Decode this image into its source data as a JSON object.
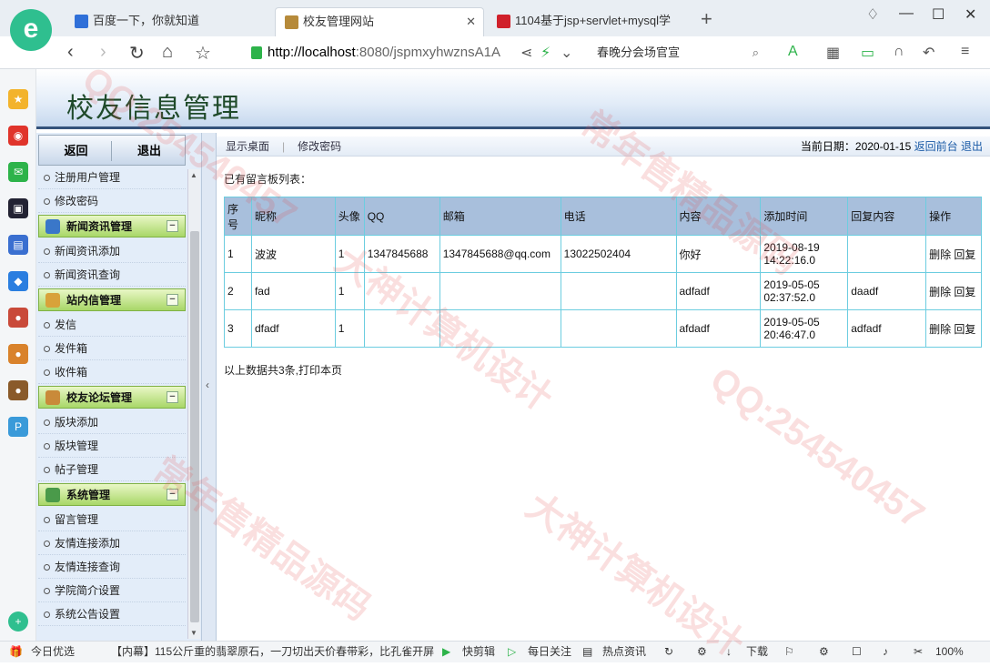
{
  "browser": {
    "tabs": [
      {
        "label": "百度一下，你就知道",
        "fav_color": "#2f6fd8"
      },
      {
        "label": "校友管理网站",
        "fav_color": "#b68a3a"
      },
      {
        "label": "1104基于jsp+servlet+mysql学",
        "fav_color": "#d0202a"
      }
    ],
    "url_host": "http://localhost",
    "url_rest": ":8080/jspmxyhwznsA1A",
    "search_text": "春晚分会场官宣",
    "logo_glyph": "e"
  },
  "app": {
    "title": "校友信息管理",
    "sidebar_buttons": {
      "back": "返回",
      "exit": "退出"
    },
    "sidebar": [
      {
        "type": "item",
        "label": "注册用户管理"
      },
      {
        "type": "item",
        "label": "修改密码"
      },
      {
        "type": "group",
        "label": "新闻资讯管理",
        "icon_color": "#3a77c9"
      },
      {
        "type": "item",
        "label": "新闻资讯添加"
      },
      {
        "type": "item",
        "label": "新闻资讯查询"
      },
      {
        "type": "group",
        "label": "站内信管理",
        "icon_color": "#d8a23a"
      },
      {
        "type": "item",
        "label": "发信"
      },
      {
        "type": "item",
        "label": "发件箱"
      },
      {
        "type": "item",
        "label": "收件箱"
      },
      {
        "type": "group",
        "label": "校友论坛管理",
        "icon_color": "#c98a3a"
      },
      {
        "type": "item",
        "label": "版块添加"
      },
      {
        "type": "item",
        "label": "版块管理"
      },
      {
        "type": "item",
        "label": "帖子管理"
      },
      {
        "type": "group",
        "label": "系统管理",
        "icon_color": "#4a9a4a"
      },
      {
        "type": "item",
        "label": "留言管理"
      },
      {
        "type": "item",
        "label": "友情连接添加"
      },
      {
        "type": "item",
        "label": "友情连接查询"
      },
      {
        "type": "item",
        "label": "学院简介设置"
      },
      {
        "type": "item",
        "label": "系统公告设置"
      }
    ],
    "topbar": {
      "show_desktop": "显示桌面",
      "change_password": "修改密码",
      "date_label": "当前日期：2020-01-15",
      "back_front": "返回前台",
      "logout": "退出"
    },
    "heading": "已有留言板列表：",
    "table": {
      "headers": [
        "序号",
        "昵称",
        "头像",
        "QQ",
        "邮箱",
        "电话",
        "内容",
        "添加时间",
        "回复内容",
        "操作"
      ],
      "rows": [
        [
          "1",
          "波波",
          "1",
          "1347845688",
          "1347845688@qq.com",
          "13022502404",
          "你好",
          "2019-08-19 14:22:16.0",
          "",
          ""
        ],
        [
          "2",
          "fad",
          "1",
          "",
          "",
          "",
          "adfadf",
          "2019-05-05 02:37:52.0",
          "daadf",
          ""
        ],
        [
          "3",
          "dfadf",
          "1",
          "",
          "",
          "",
          "afdadf",
          "2019-05-05 20:46:47.0",
          "adfadf",
          ""
        ]
      ],
      "action_delete": "删除",
      "action_reply": "回复"
    },
    "footer": "以上数据共3条,打印本页"
  },
  "statusbar": {
    "left": "今日优选",
    "news": "【内幕】115公斤重的翡翠原石，一刀切出天价春带彩，比孔雀开屏",
    "clip": "快剪辑",
    "daily": "每日关注",
    "hot": "热点资讯",
    "download": "下载",
    "zoom": "100%"
  },
  "watermarks": [
    "大神计算机设计",
    "QQ:254540457",
    "常年售精品源码"
  ]
}
